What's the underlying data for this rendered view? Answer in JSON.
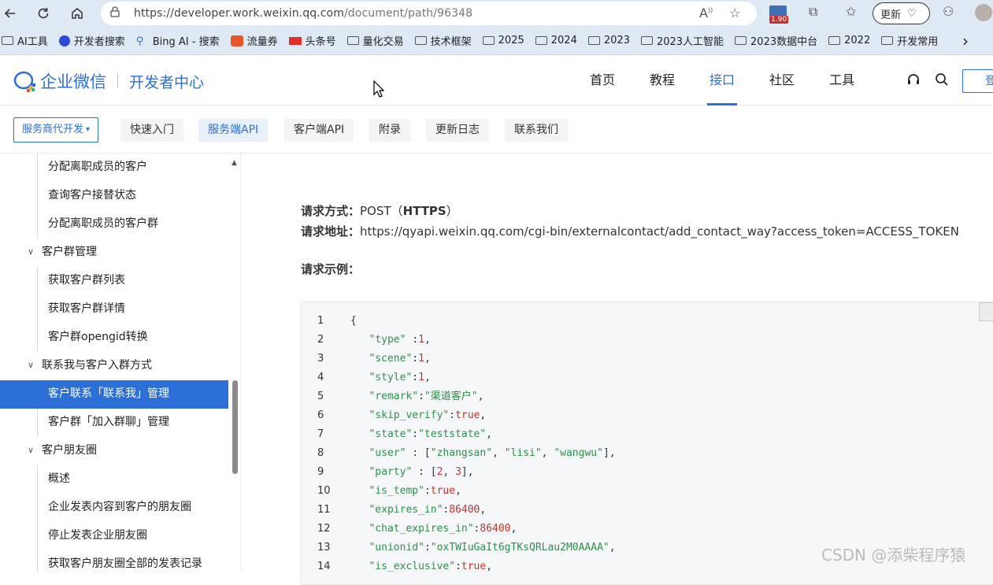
{
  "browser": {
    "url_host": "https://developer.work.weixin.qq.com",
    "url_path": "/document/path/96348",
    "extension_badge": "1.90",
    "update_label": "更新",
    "bookmarks": [
      {
        "label": "AI工具",
        "icon": "folder-icon"
      },
      {
        "label": "开发者搜索",
        "icon": "search-brand-icon"
      },
      {
        "label": "Bing AI - 搜索",
        "icon": "bing-icon"
      },
      {
        "label": "流量券",
        "icon": "c-brand-icon"
      },
      {
        "label": "头条号",
        "icon": "toutiao-icon"
      },
      {
        "label": "量化交易",
        "icon": "folder-icon"
      },
      {
        "label": "技术框架",
        "icon": "folder-icon"
      },
      {
        "label": "2025",
        "icon": "folder-icon"
      },
      {
        "label": "2024",
        "icon": "folder-icon"
      },
      {
        "label": "2023",
        "icon": "folder-icon"
      },
      {
        "label": "2023人工智能",
        "icon": "folder-icon"
      },
      {
        "label": "2023数据中台",
        "icon": "folder-icon"
      },
      {
        "label": "2022",
        "icon": "folder-icon"
      },
      {
        "label": "开发常用",
        "icon": "folder-icon"
      }
    ]
  },
  "header": {
    "logo_text": "企业微信",
    "logo_sub": "开发者中心",
    "nav": [
      "首页",
      "教程",
      "接口",
      "社区",
      "工具"
    ],
    "active_nav": "接口",
    "login_label": "登"
  },
  "subnav": {
    "select_label": "服务商代开发",
    "tabs": [
      "快速入门",
      "服务端API",
      "客户端API",
      "附录",
      "更新日志",
      "联系我们"
    ],
    "active_tab": "服务端API"
  },
  "sidebar": {
    "items": [
      {
        "label": "分配离职成员的客户",
        "type": "leaf"
      },
      {
        "label": "查询客户接替状态",
        "type": "leaf"
      },
      {
        "label": "分配离职成员的客户群",
        "type": "leaf"
      },
      {
        "label": "客户群管理",
        "type": "group"
      },
      {
        "label": "获取客户群列表",
        "type": "leaf"
      },
      {
        "label": "获取客户群详情",
        "type": "leaf"
      },
      {
        "label": "客户群opengid转换",
        "type": "leaf"
      },
      {
        "label": "联系我与客户入群方式",
        "type": "group"
      },
      {
        "label": "客户联系「联系我」管理",
        "type": "leaf",
        "active": true
      },
      {
        "label": "客户群「加入群聊」管理",
        "type": "leaf"
      },
      {
        "label": "客户朋友圈",
        "type": "group"
      },
      {
        "label": "概述",
        "type": "leaf"
      },
      {
        "label": "企业发表内容到客户的朋友圈",
        "type": "leaf"
      },
      {
        "label": "停止发表企业朋友圈",
        "type": "leaf"
      },
      {
        "label": "获取客户朋友圈全部的发表记录",
        "type": "leaf"
      }
    ]
  },
  "content": {
    "method_label": "请求方式：",
    "method_value": "POST（",
    "method_proto": "HTTPS",
    "method_close": "）",
    "url_label": "请求地址：",
    "url_value": "https://qyapi.weixin.qq.com/cgi-bin/externalcontact/add_contact_way?access_token=ACCESS_TOKEN",
    "example_label": "请求示例：",
    "code_lines": [
      {
        "n": "1",
        "parts": [
          [
            "p",
            "{"
          ]
        ]
      },
      {
        "n": "2",
        "parts": [
          [
            "p",
            "   "
          ],
          [
            "k",
            "\"type\""
          ],
          [
            "p",
            " :"
          ],
          [
            "n",
            "1"
          ],
          [
            "p",
            ","
          ]
        ]
      },
      {
        "n": "3",
        "parts": [
          [
            "p",
            "   "
          ],
          [
            "k",
            "\"scene\""
          ],
          [
            "p",
            ":"
          ],
          [
            "n",
            "1"
          ],
          [
            "p",
            ","
          ]
        ]
      },
      {
        "n": "4",
        "parts": [
          [
            "p",
            "   "
          ],
          [
            "k",
            "\"style\""
          ],
          [
            "p",
            ":"
          ],
          [
            "n",
            "1"
          ],
          [
            "p",
            ","
          ]
        ]
      },
      {
        "n": "5",
        "parts": [
          [
            "p",
            "   "
          ],
          [
            "k",
            "\"remark\""
          ],
          [
            "p",
            ":"
          ],
          [
            "s",
            "\"渠道客户\""
          ],
          [
            "p",
            ","
          ]
        ]
      },
      {
        "n": "6",
        "parts": [
          [
            "p",
            "   "
          ],
          [
            "k",
            "\"skip_verify\""
          ],
          [
            "p",
            ":"
          ],
          [
            "n",
            "true"
          ],
          [
            "p",
            ","
          ]
        ]
      },
      {
        "n": "7",
        "parts": [
          [
            "p",
            "   "
          ],
          [
            "k",
            "\"state\""
          ],
          [
            "p",
            ":"
          ],
          [
            "s",
            "\"teststate\""
          ],
          [
            "p",
            ","
          ]
        ]
      },
      {
        "n": "8",
        "parts": [
          [
            "p",
            "   "
          ],
          [
            "k",
            "\"user\""
          ],
          [
            "p",
            " : ["
          ],
          [
            "s",
            "\"zhangsan\""
          ],
          [
            "p",
            ", "
          ],
          [
            "s",
            "\"lisi\""
          ],
          [
            "p",
            ", "
          ],
          [
            "s",
            "\"wangwu\""
          ],
          [
            "p",
            "],"
          ]
        ]
      },
      {
        "n": "9",
        "parts": [
          [
            "p",
            "   "
          ],
          [
            "k",
            "\"party\""
          ],
          [
            "p",
            " : ["
          ],
          [
            "n",
            "2"
          ],
          [
            "p",
            ", "
          ],
          [
            "n",
            "3"
          ],
          [
            "p",
            "],"
          ]
        ]
      },
      {
        "n": "10",
        "parts": [
          [
            "p",
            "   "
          ],
          [
            "k",
            "\"is_temp\""
          ],
          [
            "p",
            ":"
          ],
          [
            "n",
            "true"
          ],
          [
            "p",
            ","
          ]
        ]
      },
      {
        "n": "11",
        "parts": [
          [
            "p",
            "   "
          ],
          [
            "k",
            "\"expires_in\""
          ],
          [
            "p",
            ":"
          ],
          [
            "n",
            "86400"
          ],
          [
            "p",
            ","
          ]
        ]
      },
      {
        "n": "12",
        "parts": [
          [
            "p",
            "   "
          ],
          [
            "k",
            "\"chat_expires_in\""
          ],
          [
            "p",
            ":"
          ],
          [
            "n",
            "86400"
          ],
          [
            "p",
            ","
          ]
        ]
      },
      {
        "n": "13",
        "parts": [
          [
            "p",
            "   "
          ],
          [
            "k",
            "\"unionid\""
          ],
          [
            "p",
            ":"
          ],
          [
            "s",
            "\"oxTWIuGaIt6gTKsQRLau2M0AAAA\""
          ],
          [
            "p",
            ","
          ]
        ]
      },
      {
        "n": "14",
        "parts": [
          [
            "p",
            "   "
          ],
          [
            "k",
            "\"is_exclusive\""
          ],
          [
            "p",
            ":"
          ],
          [
            "n",
            "true"
          ],
          [
            "p",
            ","
          ]
        ]
      }
    ]
  },
  "watermark": "CSDN @添柴程序猿",
  "colors": {
    "accent": "#2c6fd6",
    "code_key": "#2f8f4e",
    "code_number": "#c4322f"
  }
}
